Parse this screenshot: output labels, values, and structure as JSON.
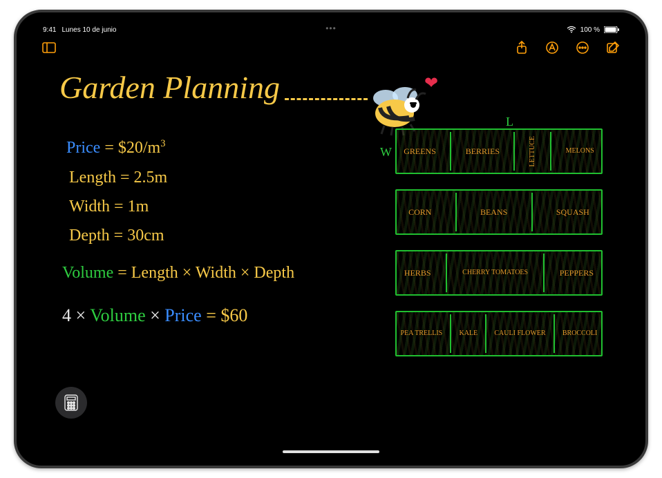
{
  "status": {
    "time": "9:41",
    "date": "Lunes 10 de junio",
    "battery": "100 %"
  },
  "note": {
    "title": "Garden Planning",
    "lines": {
      "price_label": "Price",
      "price_value": "= $20/m",
      "price_exp": "3",
      "length_label": "Length",
      "length_value": "= 2.5m",
      "width_label": "Width",
      "width_value": "= 1m",
      "depth_label": "Depth",
      "depth_value": "= 30cm",
      "vol_label": "Volume",
      "vol_expr": "= Length × Width × Depth",
      "final_4": "4 ×",
      "final_vol": "Volume",
      "final_x": "×",
      "final_price": "Price",
      "final_eq": "= $60"
    },
    "axes": {
      "L": "L",
      "W": "W"
    },
    "beds": [
      [
        "GREENS",
        "BERRIES",
        "LETTUCE",
        "MELONS"
      ],
      [
        "CORN",
        "BEANS",
        "SQUASH"
      ],
      [
        "HERBS",
        "CHERRY TOMATOES",
        "PEPPERS"
      ],
      [
        "PEA TRELLIS",
        "KALE",
        "CAULI FLOWER",
        "BROCCOLI"
      ]
    ]
  }
}
